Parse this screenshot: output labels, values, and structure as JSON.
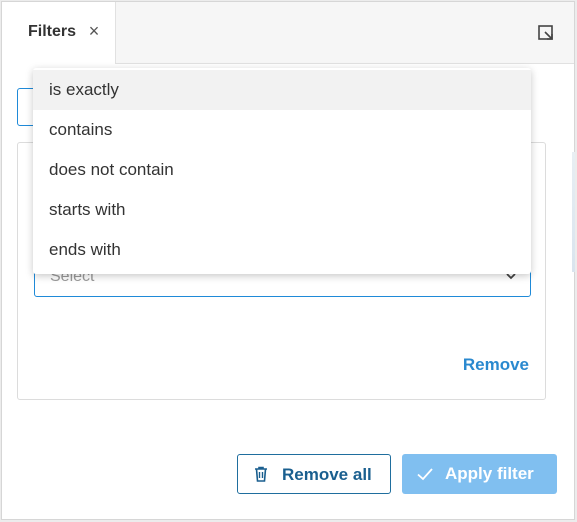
{
  "tabs": [
    {
      "label": "Filters"
    }
  ],
  "tab_close_icon": "close-icon",
  "popout_icon": "popout-icon",
  "rule": {
    "select_placeholder": "Select",
    "remove_label": "Remove"
  },
  "dropdown": {
    "options": [
      {
        "label": "is exactly",
        "highlighted": true
      },
      {
        "label": "contains"
      },
      {
        "label": "does not contain"
      },
      {
        "label": "starts with"
      },
      {
        "label": "ends with"
      }
    ]
  },
  "footer": {
    "remove_all_label": "Remove all",
    "apply_label": "Apply filter"
  },
  "colors": {
    "accent": "#1f8ad8",
    "apply_disabled": "#80bff0",
    "remove_all_text": "#1a5f8f"
  }
}
